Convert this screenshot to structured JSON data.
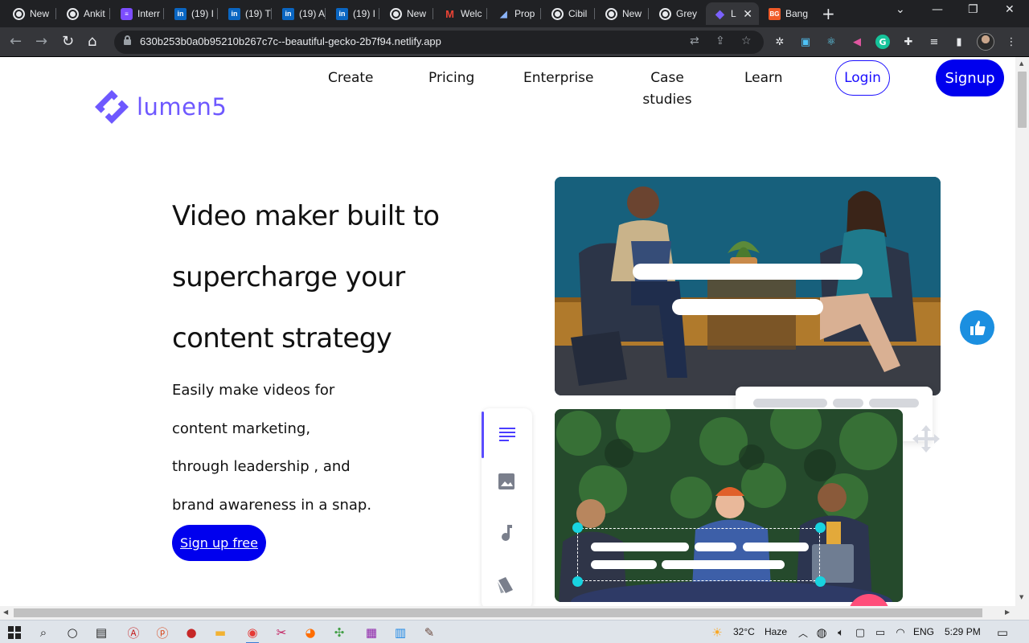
{
  "browser": {
    "tabs": [
      {
        "label": "New",
        "icon": "globe-icon"
      },
      {
        "label": "Ankit",
        "icon": "globe-icon"
      },
      {
        "label": "Interr",
        "icon": "list-icon"
      },
      {
        "label": "(19) I",
        "icon": "linkedin-icon"
      },
      {
        "label": "(19) T",
        "icon": "linkedin-icon"
      },
      {
        "label": "(19) A",
        "icon": "linkedin-icon"
      },
      {
        "label": "(19) I",
        "icon": "linkedin-icon"
      },
      {
        "label": "New",
        "icon": "globe-icon"
      },
      {
        "label": "Welc",
        "icon": "gmail-icon"
      },
      {
        "label": "Prop",
        "icon": "prop-icon"
      },
      {
        "label": "Cibil",
        "icon": "globe-icon"
      },
      {
        "label": "New",
        "icon": "globe-icon"
      },
      {
        "label": "Grey",
        "icon": "globe-icon"
      },
      {
        "label": "L",
        "icon": "lumen5-icon"
      },
      {
        "label": "Bang",
        "icon": "bg-icon"
      }
    ],
    "url": "630b253b0a0b95210b267c7c--beautiful-gecko-2b7f94.netlify.app"
  },
  "header": {
    "logo_text": "lumen5",
    "nav": {
      "create": "Create",
      "pricing": "Pricing",
      "enterprise": "Enterprise",
      "case_line1": "Case",
      "case_line2": "studies",
      "learn": "Learn"
    },
    "login": "Login",
    "signup": "Signup"
  },
  "hero": {
    "headline": [
      "Video maker built to",
      "supercharge your",
      "content strategy"
    ],
    "sub": [
      "Easily make videos for",
      "content marketing,",
      "through leadership , and",
      "brand awareness in a snap."
    ],
    "cta": "Sign up free"
  },
  "colors": {
    "brand": "#6e58ff",
    "primary_button": "#0000ee",
    "like_button": "#1b8fe0",
    "handle": "#18d3e0"
  },
  "taskbar": {
    "temperature": "32°C",
    "weather": "Haze",
    "language": "ENG",
    "time": "5:29 PM"
  }
}
